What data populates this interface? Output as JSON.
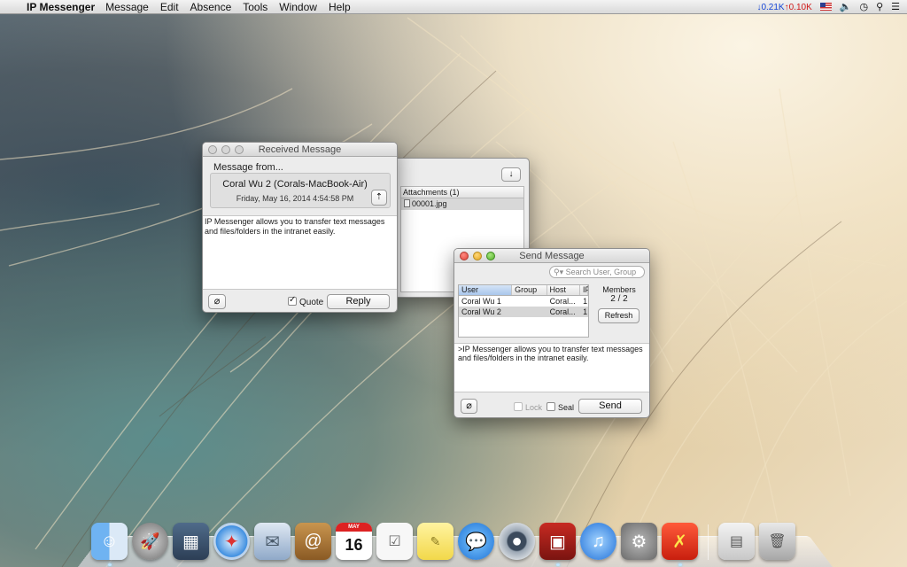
{
  "menubar": {
    "app_name": "IP Messenger",
    "items": [
      "Message",
      "Edit",
      "Absence",
      "Tools",
      "Window",
      "Help"
    ],
    "net_down": "↓0.21K",
    "net_up": "↑0.10K"
  },
  "received_window": {
    "title": "Received Message",
    "from_label": "Message from...",
    "sender": "Coral Wu 2 (Corals-MacBook-Air)",
    "date": "Friday, May 16, 2014 4:54:58 PM",
    "message": "IP Messenger allows you to transfer text messages and files/folders in the intranet easily.",
    "quote_label": "Quote",
    "quote_checked": true,
    "reply_label": "Reply"
  },
  "attachments_window": {
    "header": "Attachments (1)",
    "files": [
      "00001.jpg"
    ]
  },
  "send_window": {
    "title": "Send Message",
    "search_placeholder": "Search User, Group",
    "columns": [
      "User",
      "Group",
      "Host",
      "IP"
    ],
    "rows": [
      {
        "user": "Coral Wu 1",
        "group": "",
        "host": "Coral...",
        "ip": "1"
      },
      {
        "user": "Coral Wu 2",
        "group": "",
        "host": "Coral...",
        "ip": "1"
      }
    ],
    "members_label": "Members",
    "members_count": "2 / 2",
    "refresh_label": "Refresh",
    "message": ">IP Messenger allows you to transfer text messages and files/folders in the intranet easily.",
    "lock_label": "Lock",
    "seal_label": "Seal",
    "send_label": "Send"
  },
  "dock": {
    "calendar_month": "MAY",
    "calendar_day": "16"
  },
  "colors": {
    "net_down": "#1545d6",
    "net_up": "#d01a1a",
    "selection_row": "#d6d6d6"
  }
}
